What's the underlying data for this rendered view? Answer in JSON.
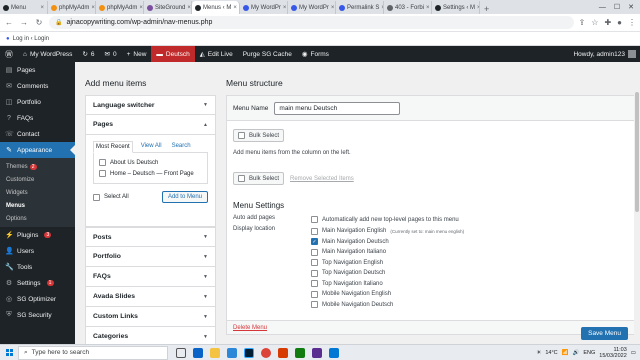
{
  "browser": {
    "tabs": [
      {
        "label": "Menu",
        "color": "#1d2327"
      },
      {
        "label": "phpMyAdm",
        "color": "#f29111"
      },
      {
        "label": "phpMyAdm",
        "color": "#f29111"
      },
      {
        "label": "SiteGround",
        "color": "#7b4fa0"
      },
      {
        "label": "Menus ‹ M",
        "color": "#1d2327",
        "active": true
      },
      {
        "label": "My WordPr",
        "color": "#3858e9"
      },
      {
        "label": "My WordPr",
        "color": "#3858e9"
      },
      {
        "label": "Permalink S",
        "color": "#3858e9"
      },
      {
        "label": "403 - Forbi",
        "color": "#5f6368"
      },
      {
        "label": "Settings ‹ M",
        "color": "#1d2327"
      }
    ],
    "new_tab": "+",
    "url": "ajnacopywriting.com/wp-admin/nav-menus.php",
    "bookmark": "Log in ‹ Login"
  },
  "adminbar": {
    "site_name": "My WordPress",
    "updates": "6",
    "comments": "0",
    "new_label": "New",
    "language": "Deutsch",
    "edit_live": "Edit Live",
    "purge": "Purge SG Cache",
    "forms": "Forms",
    "howdy": "Howdy, admin123"
  },
  "sidebar": {
    "items": [
      {
        "label": "Pages",
        "icon": "pages-icon"
      },
      {
        "label": "Comments",
        "icon": "comments-icon"
      },
      {
        "label": "Portfolio",
        "icon": "portfolio-icon"
      },
      {
        "label": "FAQs",
        "icon": "faqs-icon"
      },
      {
        "label": "Contact",
        "icon": "contact-icon"
      }
    ],
    "appearance": "Appearance",
    "sub": {
      "themes": "Themes",
      "themes_badge": "2",
      "customize": "Customize",
      "widgets": "Widgets",
      "menus": "Menus",
      "options": "Options"
    },
    "plugins": "Plugins",
    "plugins_badge": "3",
    "users": "Users",
    "tools": "Tools",
    "settings": "Settings",
    "settings_badge": "1",
    "sg_optimizer": "SG Optimizer",
    "sg_security": "SG Security"
  },
  "left": {
    "title": "Add menu items",
    "language_switcher": "Language switcher",
    "pages": "Pages",
    "tabs": [
      "Most Recent",
      "View All",
      "Search"
    ],
    "page_items": [
      "About Us Deutsch",
      "Home – Deutsch — Front Page"
    ],
    "select_all": "Select All",
    "add_to_menu": "Add to Menu",
    "sections": [
      "Posts",
      "Portfolio",
      "FAQs",
      "Avada Slides",
      "Custom Links",
      "Categories"
    ]
  },
  "right": {
    "title": "Menu structure",
    "menu_name_label": "Menu Name",
    "menu_name_value": "main menu Deutsch",
    "bulk_select": "Bulk Select",
    "hint": "Add menu items from the column on the left.",
    "remove_selected": "Remove Selected Items",
    "settings_title": "Menu Settings",
    "auto_add_label": "Auto add pages",
    "auto_add_text": "Automatically add new top-level pages to this menu",
    "display_location_label": "Display location",
    "locations": [
      {
        "label": "Main Navigation English",
        "note": "(Currently set to: main menu english)",
        "checked": false
      },
      {
        "label": "Main Navigation Deutsch",
        "note": "",
        "checked": true
      },
      {
        "label": "Main Navigation Italiano",
        "note": "",
        "checked": false
      },
      {
        "label": "Top Navigation English",
        "note": "",
        "checked": false
      },
      {
        "label": "Top Navigation Deutsch",
        "note": "",
        "checked": false
      },
      {
        "label": "Top Navigation Italiano",
        "note": "",
        "checked": false
      },
      {
        "label": "Mobile Navigation English",
        "note": "",
        "checked": false
      },
      {
        "label": "Mobile Navigation Deutsch",
        "note": "",
        "checked": false
      }
    ],
    "delete_menu": "Delete Menu",
    "save_menu": "Save Menu"
  },
  "taskbar": {
    "search_placeholder": "Type here to search",
    "weather": "14°C",
    "time": "11:03",
    "date": "15/03/2022",
    "lang": "ENG"
  }
}
